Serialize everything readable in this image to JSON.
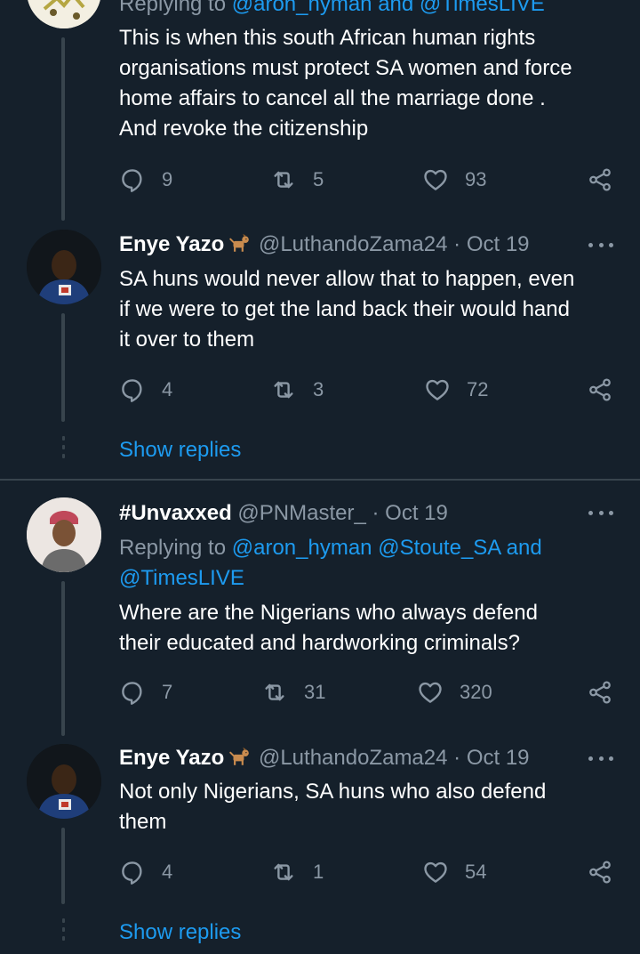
{
  "colors": {
    "background": "#15202b",
    "text": "#ffffff",
    "muted": "#8b98a5",
    "accent": "#1d9bf0",
    "line": "#38444d"
  },
  "top_tweet": {
    "reply_to_prefix": "Replying to ",
    "reply_to_mentions": "@aron_hyman and @TimesLIVE",
    "text_lines": [
      "This is when this south African human rights",
      "organisations must protect SA women and force",
      "home affairs to cancel all the marriage done .",
      "And revoke the citizenship"
    ],
    "replies": "9",
    "retweets": "5",
    "likes": "93"
  },
  "reply_1": {
    "name": "Enye Yazo",
    "name_emoji": "dog-emoji",
    "handle": "@LuthandoZama24",
    "date": "· Oct 19",
    "text_lines": [
      "SA huns would never allow that to happen, even",
      "if we were to get the land back their would hand",
      "it over to them"
    ],
    "replies": "4",
    "retweets": "3",
    "likes": "72"
  },
  "show_replies_label": "Show replies",
  "tweet_2": {
    "name": "#Unvaxxed",
    "handle": "@PNMaster_",
    "date": " · Oct 19",
    "reply_to_prefix": "Replying to ",
    "reply_to_line1_mentions": "@aron_hyman @Stoute_SA",
    "reply_to_and": " and",
    "reply_to_line2": "@TimesLIVE",
    "text_lines": [
      "Where are the Nigerians who always defend",
      "their educated and hardworking criminals?"
    ],
    "replies": "7",
    "retweets": "31",
    "likes": "320"
  },
  "reply_2": {
    "name": "Enye Yazo",
    "name_emoji": "dog-emoji",
    "handle": "@LuthandoZama24",
    "date": "· Oct 19",
    "text_lines": [
      "Not only Nigerians, SA huns who also defend",
      "them"
    ],
    "replies": "4",
    "retweets": "1",
    "likes": "54"
  },
  "show_replies_label_2": "Show replies"
}
